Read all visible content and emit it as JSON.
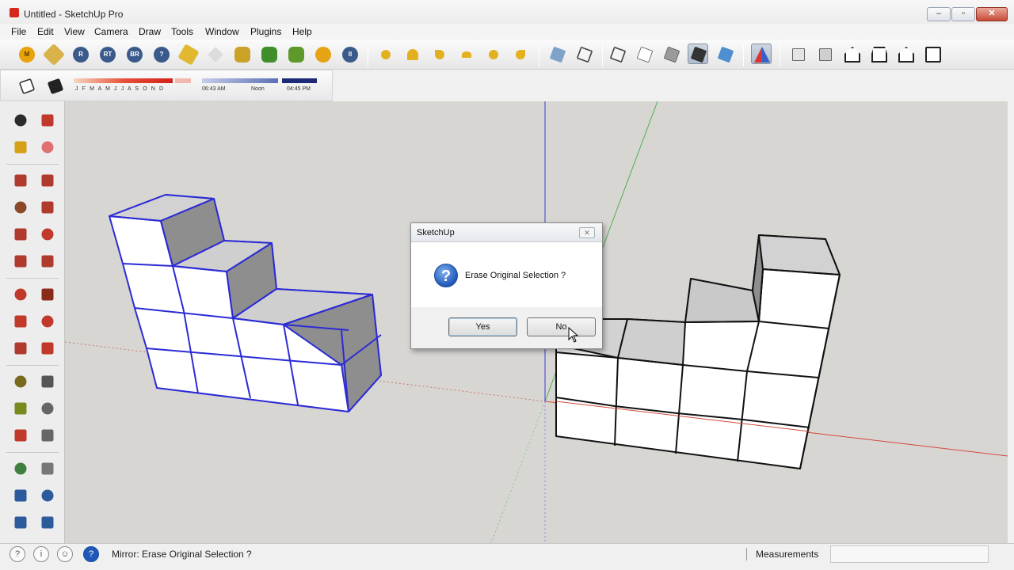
{
  "window": {
    "title": "Untitled - SketchUp Pro"
  },
  "menu": [
    "File",
    "Edit",
    "View",
    "Camera",
    "Draw",
    "Tools",
    "Window",
    "Plugins",
    "Help"
  ],
  "toolbar": {
    "icons": [
      "m-plugin-icon",
      "tag-icon",
      "r-plugin-icon",
      "rt-plugin-icon",
      "br-plugin-icon",
      "circle-tool-icon",
      "label-icon",
      "diamond-icon",
      "flower-icon",
      "tree-icon",
      "tree-alt-icon",
      "sun-icon",
      "pause-icon",
      "sphere-icon",
      "umbrella-icon",
      "cone-icon",
      "dome-icon",
      "ball-icon",
      "pin-icon",
      "iso-view-icon",
      "top-view-icon",
      "front-view-icon",
      "right-view-icon",
      "back-view-icon",
      "left-view-icon",
      "xray-icon",
      "shaded-icon",
      "textured-icon",
      "section-icon",
      "component-icon",
      "group-icon",
      "house-icon",
      "house-outline-icon",
      "house-alt-icon",
      "box-icon"
    ]
  },
  "shadow_slider": {
    "months": "J F M A M J J A S O N D",
    "time_start": "06:43 AM",
    "time_mid": "Noon",
    "time_end": "04:45 PM"
  },
  "sidebar": {
    "tools": [
      "select-tool-icon",
      "make-component-icon",
      "paint-bucket-icon",
      "eraser-icon",
      "rectangle-tool-icon",
      "line-tool-icon",
      "circle-tool-icon",
      "arc-tool-icon",
      "polygon-tool-icon",
      "freehand-tool-icon",
      "pie-tool-icon",
      "two-point-arc-icon",
      "move-tool-icon",
      "push-pull-icon",
      "rotate-tool-icon",
      "follow-me-icon",
      "scale-tool-icon",
      "offset-tool-icon",
      "tape-measure-icon",
      "dimension-icon",
      "protractor-icon",
      "text-tool-icon",
      "axes-tool-icon",
      "3d-text-icon",
      "orbit-icon",
      "pan-icon",
      "zoom-icon",
      "zoom-window-icon",
      "zoom-extents-icon",
      "previous-view-icon"
    ]
  },
  "dialog": {
    "title": "SketchUp",
    "message": "Erase Original Selection ?",
    "yes_label": "Yes",
    "no_label": "No"
  },
  "statusbar": {
    "text": "Mirror: Erase Original Selection ?",
    "measurements_label": "Measurements",
    "measurements_value": ""
  },
  "colors": {
    "selection_edge": "#2b2bd6",
    "red_axis": "#d24a3c",
    "green_axis": "#4caf50",
    "blue_axis": "#3a3ad6",
    "face_top": "#c8c8c8",
    "face_side": "#8e8e8e",
    "face_front": "#ffffff"
  }
}
